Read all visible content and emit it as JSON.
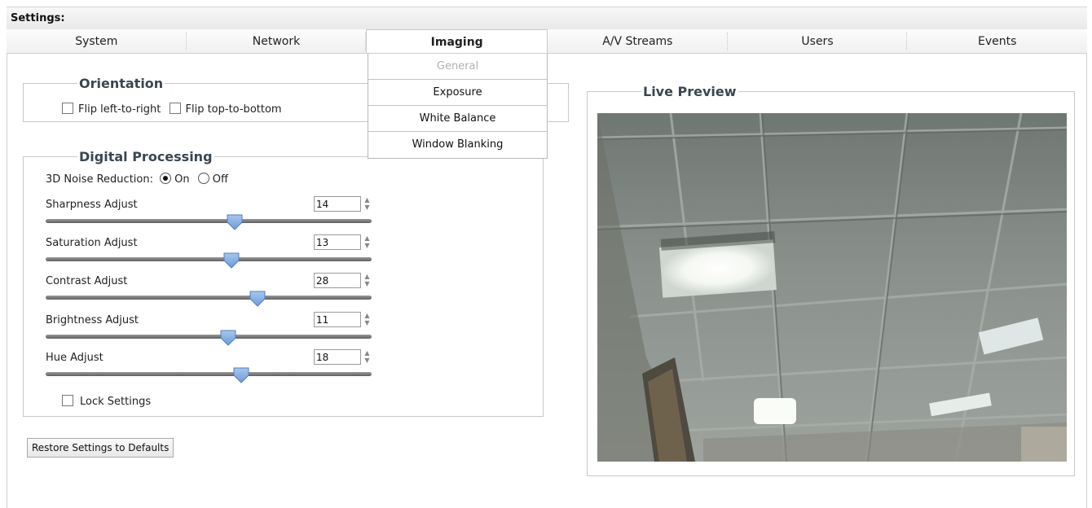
{
  "header": {
    "title": "Settings:"
  },
  "tabs": [
    {
      "label": "System"
    },
    {
      "label": "Network"
    },
    {
      "label": "Imaging",
      "active": true
    },
    {
      "label": "A/V Streams"
    },
    {
      "label": "Users"
    },
    {
      "label": "Events"
    }
  ],
  "imaging_menu": [
    {
      "label": "General",
      "disabled": true
    },
    {
      "label": "Exposure"
    },
    {
      "label": "White Balance"
    },
    {
      "label": "Window Blanking"
    }
  ],
  "orientation": {
    "legend": "Orientation",
    "flip_lr_label": "Flip left-to-right",
    "flip_tb_label": "Flip top-to-bottom",
    "flip_lr": false,
    "flip_tb": false
  },
  "digital": {
    "legend": "Digital Processing",
    "noise_label": "3D Noise Reduction:",
    "noise_on_label": "On",
    "noise_off_label": "Off",
    "noise_selected": "On",
    "sliders": [
      {
        "label": "Sharpness Adjust",
        "value": "14",
        "level": 0.58
      },
      {
        "label": "Saturation Adjust",
        "value": "13",
        "level": 0.57
      },
      {
        "label": "Contrast Adjust",
        "value": "28",
        "level": 0.65
      },
      {
        "label": "Brightness Adjust",
        "value": "11",
        "level": 0.56
      },
      {
        "label": "Hue Adjust",
        "value": "18",
        "level": 0.6
      }
    ],
    "lock_label": "Lock Settings",
    "lock_checked": false
  },
  "restore_label": "Restore Settings to Defaults",
  "preview": {
    "legend": "Live Preview"
  },
  "colors": {
    "thumb": "#6c9bd6",
    "legend": "#3a4652"
  }
}
